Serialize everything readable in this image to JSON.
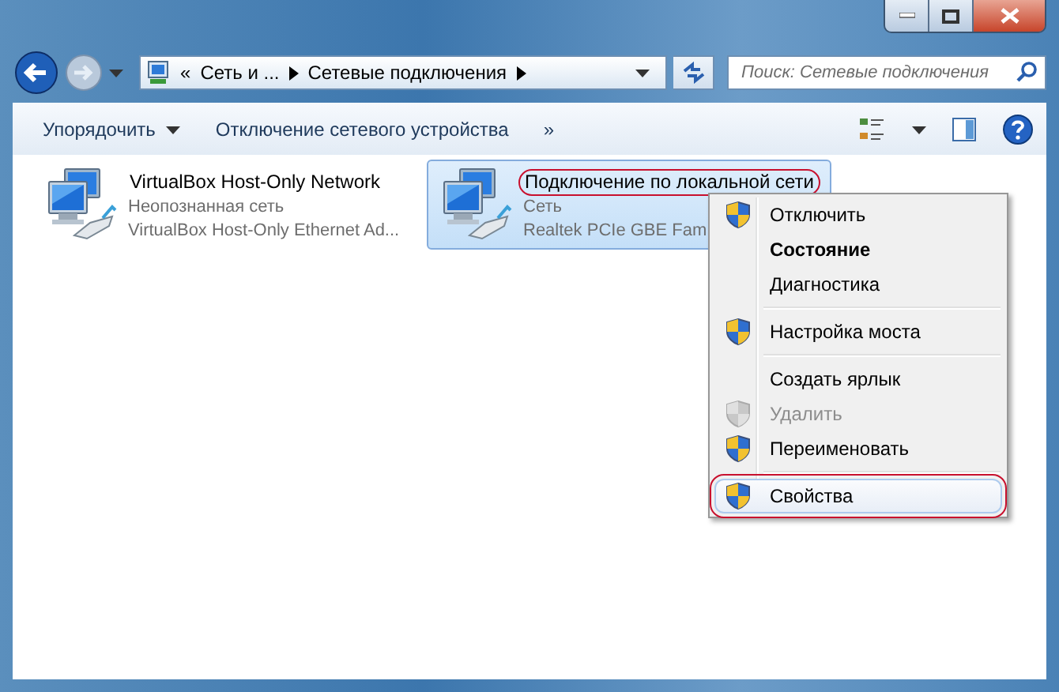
{
  "navigation": {
    "overflow_mark": "«",
    "breadcrumbs": [
      "Сеть и ...",
      "Сетевые подключения"
    ]
  },
  "search": {
    "placeholder": "Поиск: Сетевые подключения"
  },
  "toolbar": {
    "items": [
      "Упорядочить",
      "Отключение сетевого устройства"
    ],
    "more": "»"
  },
  "connections": [
    {
      "name": "VirtualBox Host-Only Network",
      "status": "Неопознанная сеть",
      "adapter": "VirtualBox Host-Only Ethernet Ad...",
      "selected": false,
      "circled": false
    },
    {
      "name": "Подключение по локальной сети",
      "status": "Сеть",
      "adapter": "Realtek PCIe GBE Fam",
      "selected": true,
      "circled": true
    }
  ],
  "context_menu": [
    {
      "kind": "item",
      "label": "Отключить",
      "shield": true,
      "bold": false,
      "disabled": false,
      "selected": false,
      "circled": false
    },
    {
      "kind": "item",
      "label": "Состояние",
      "shield": false,
      "bold": true,
      "disabled": false,
      "selected": false,
      "circled": false
    },
    {
      "kind": "item",
      "label": "Диагностика",
      "shield": false,
      "bold": false,
      "disabled": false,
      "selected": false,
      "circled": false
    },
    {
      "kind": "separator"
    },
    {
      "kind": "item",
      "label": "Настройка моста",
      "shield": true,
      "bold": false,
      "disabled": false,
      "selected": false,
      "circled": false
    },
    {
      "kind": "separator"
    },
    {
      "kind": "item",
      "label": "Создать ярлык",
      "shield": false,
      "bold": false,
      "disabled": false,
      "selected": false,
      "circled": false
    },
    {
      "kind": "item",
      "label": "Удалить",
      "shield": true,
      "bold": false,
      "disabled": true,
      "selected": false,
      "circled": false
    },
    {
      "kind": "item",
      "label": "Переименовать",
      "shield": true,
      "bold": false,
      "disabled": false,
      "selected": false,
      "circled": false
    },
    {
      "kind": "separator"
    },
    {
      "kind": "item",
      "label": "Свойства",
      "shield": true,
      "bold": false,
      "disabled": false,
      "selected": true,
      "circled": true
    }
  ]
}
